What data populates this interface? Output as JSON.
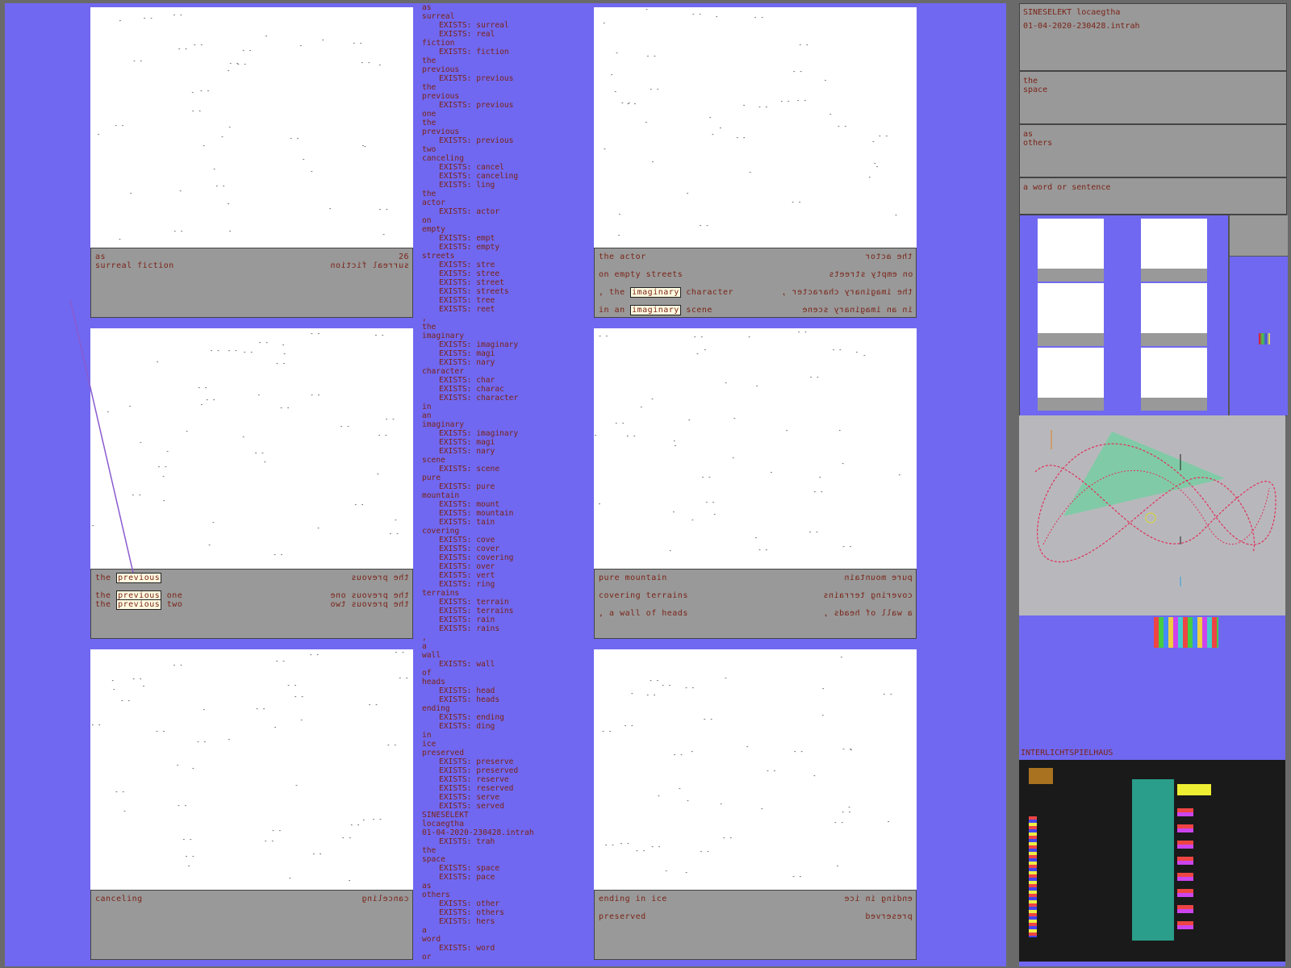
{
  "panels": [
    {
      "caption_left": [
        "as",
        "surreal fiction"
      ],
      "caption_right": [
        "surreal fiction"
      ],
      "number": "26"
    },
    {
      "caption_left": [
        "the actor",
        "on empty streets",
        ", the imaginary character",
        "in an imaginary scene"
      ],
      "caption_right": [
        "the actor",
        "on empty streets",
        "the imaginary character ,",
        "in an imaginary scene"
      ],
      "highlight": "imaginary"
    },
    {
      "caption_left": [
        "the previous",
        "the previous one",
        "the previous two"
      ],
      "caption_right": [
        "the prevous",
        "the prevous one",
        "the prevous two"
      ],
      "highlight": "previous"
    },
    {
      "caption_left": [
        "pure mountain",
        "covering terrains",
        ", a wall of heads"
      ],
      "caption_right": [
        "pure mountain",
        "covering terrains",
        "a wall of heads ,"
      ]
    },
    {
      "caption_left": [
        "canceling"
      ],
      "caption_right": [
        "canceling"
      ]
    },
    {
      "caption_left": [
        "ending in ice",
        "preserved"
      ],
      "caption_right": [
        "ending in ice",
        "preserved"
      ]
    }
  ],
  "word_list": [
    {
      "w": "as"
    },
    {
      "w": "surreal",
      "ex": [
        "surreal",
        "real"
      ]
    },
    {
      "w": "fiction",
      "ex": [
        "fiction"
      ]
    },
    {
      "w": "the"
    },
    {
      "w": "previous",
      "ex": [
        "previous"
      ]
    },
    {
      "w": "the"
    },
    {
      "w": "previous",
      "ex": [
        "previous"
      ]
    },
    {
      "w": "one"
    },
    {
      "w": "the"
    },
    {
      "w": "previous",
      "ex": [
        "previous"
      ]
    },
    {
      "w": "two"
    },
    {
      "w": "canceling",
      "ex": [
        "cancel",
        "canceling",
        "ling"
      ]
    },
    {
      "w": "the"
    },
    {
      "w": "actor",
      "ex": [
        "actor"
      ]
    },
    {
      "w": "on"
    },
    {
      "w": "empty",
      "ex": [
        "empt",
        "empty"
      ]
    },
    {
      "w": "streets",
      "ex": [
        "stre",
        "stree",
        "street",
        "streets",
        "tree",
        "reet"
      ]
    },
    {
      "w": ","
    },
    {
      "w": "the"
    },
    {
      "w": "imaginary",
      "ex": [
        "imaginary",
        "magi",
        "nary"
      ]
    },
    {
      "w": "character",
      "ex": [
        "char",
        "charac",
        "character"
      ]
    },
    {
      "w": "in"
    },
    {
      "w": "an"
    },
    {
      "w": "imaginary",
      "ex": [
        "imaginary",
        "magi",
        "nary"
      ]
    },
    {
      "w": "scene",
      "ex": [
        "scene"
      ]
    },
    {
      "w": "pure",
      "ex": [
        "pure"
      ]
    },
    {
      "w": "mountain",
      "ex": [
        "mount",
        "mountain",
        "tain"
      ]
    },
    {
      "w": "covering",
      "ex": [
        "cove",
        "cover",
        "covering",
        "over",
        "vert",
        "ring"
      ]
    },
    {
      "w": "terrains",
      "ex": [
        "terrain",
        "terrains",
        "rain",
        "rains"
      ]
    },
    {
      "w": ","
    },
    {
      "w": "a"
    },
    {
      "w": "wall",
      "ex": [
        "wall"
      ]
    },
    {
      "w": "of"
    },
    {
      "w": "heads",
      "ex": [
        "head",
        "heads"
      ]
    },
    {
      "w": "ending",
      "ex": [
        "ending",
        "ding"
      ]
    },
    {
      "w": "in"
    },
    {
      "w": "ice"
    },
    {
      "w": "preserved",
      "ex": [
        "preserve",
        "preserved",
        "reserve",
        "reserved",
        "serve",
        "served"
      ]
    },
    {
      "w": "SINESELEKT"
    },
    {
      "w": "locaegtha"
    },
    {
      "w": "01-04-2020-230428.intrah",
      "ex": [
        "trah"
      ]
    },
    {
      "w": "the"
    },
    {
      "w": "space",
      "ex": [
        "space",
        "pace"
      ]
    },
    {
      "w": "as"
    },
    {
      "w": "others",
      "ex": [
        "other",
        "others",
        "hers"
      ]
    },
    {
      "w": "a"
    },
    {
      "w": "word",
      "ex": [
        "word"
      ]
    },
    {
      "w": "or"
    }
  ],
  "exists_prefix": "EXISTS:",
  "side": {
    "header_title": "SINESELEKT locaegtha",
    "header_sub": "01-04-2020-230428.intrah",
    "box2": "the\nspace",
    "box3": "as\nothers",
    "box4": "a word or sentence",
    "dark_label": "INTERLICHTSPIELHAUS"
  },
  "colors": {
    "background": "#7068f0",
    "caption_text": "#7a2418",
    "caption_bg": "#999999",
    "curve": "#e0305a",
    "cone": "#6fd0a0"
  }
}
